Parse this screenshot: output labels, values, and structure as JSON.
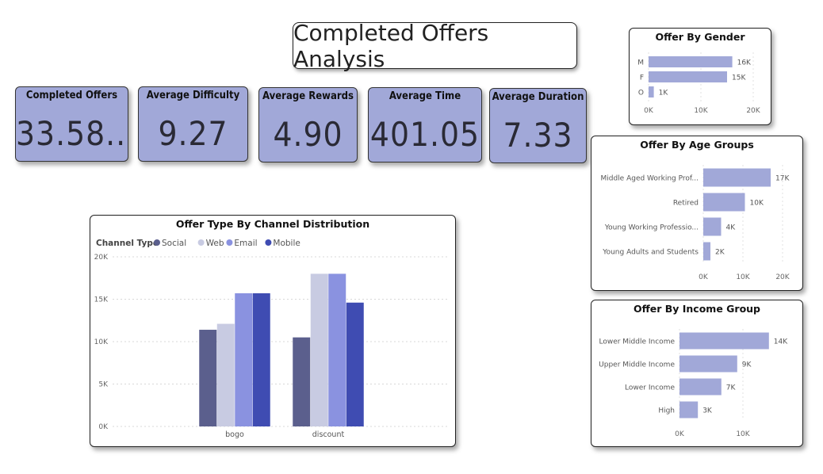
{
  "title": "Completed Offers Analysis",
  "colors": {
    "kpi_bg": "#a1a8d8",
    "hbar": "#a1a8d8",
    "social": "#5b5f8d",
    "web": "#c8cbe2",
    "email": "#8a92e0",
    "mobile": "#3f4cb2"
  },
  "kpis": [
    {
      "label": "Completed Offers",
      "value": "33.58..."
    },
    {
      "label": "Average Difficulty",
      "value": "9.27"
    },
    {
      "label": "Average Rewards",
      "value": "4.90"
    },
    {
      "label": "Average Time",
      "value": "401.05"
    },
    {
      "label": "Average Duration",
      "value": "7.33"
    }
  ],
  "channel_chart": {
    "legend_title": "Channel Type"
  },
  "chart_data": [
    {
      "type": "bar",
      "title": "Offer Type By Channel Distribution",
      "categories": [
        "bogo",
        "discount"
      ],
      "series": [
        {
          "name": "Social",
          "values": [
            11400,
            10500
          ]
        },
        {
          "name": "Web",
          "values": [
            12100,
            18000
          ]
        },
        {
          "name": "Email",
          "values": [
            15700,
            18000
          ]
        },
        {
          "name": "Mobile",
          "values": [
            15700,
            14600
          ]
        }
      ],
      "yticks": [
        "0K",
        "5K",
        "10K",
        "15K",
        "20K"
      ],
      "ylim": [
        0,
        20000
      ],
      "legend_position": "top-left",
      "grid": true
    },
    {
      "type": "bar",
      "orientation": "horizontal",
      "title": "Offer By Gender",
      "categories": [
        "M",
        "F",
        "O"
      ],
      "values": [
        16000,
        15000,
        1000
      ],
      "labels": [
        "16K",
        "15K",
        "1K"
      ],
      "xticks": [
        "0K",
        "10K",
        "20K"
      ],
      "xlim": [
        0,
        20000
      ]
    },
    {
      "type": "bar",
      "orientation": "horizontal",
      "title": "Offer By Age Groups",
      "categories": [
        "Middle Aged Working Prof...",
        "Retired",
        "Young Working Professio...",
        "Young Adults and Students"
      ],
      "values": [
        17000,
        10500,
        4500,
        1800
      ],
      "labels": [
        "17K",
        "10K",
        "4K",
        "2K"
      ],
      "xticks": [
        "0K",
        "10K",
        "20K"
      ],
      "xlim": [
        0,
        20000
      ]
    },
    {
      "type": "bar",
      "orientation": "horizontal",
      "title": "Offer By Income Group",
      "categories": [
        "Lower Middle Income",
        "Upper Middle Income",
        "Lower Income",
        "High"
      ],
      "values": [
        14100,
        9100,
        6600,
        2900
      ],
      "labels": [
        "14K",
        "9K",
        "7K",
        "3K"
      ],
      "xticks": [
        "0K",
        "10K"
      ],
      "xlim": [
        0,
        15000
      ]
    }
  ]
}
